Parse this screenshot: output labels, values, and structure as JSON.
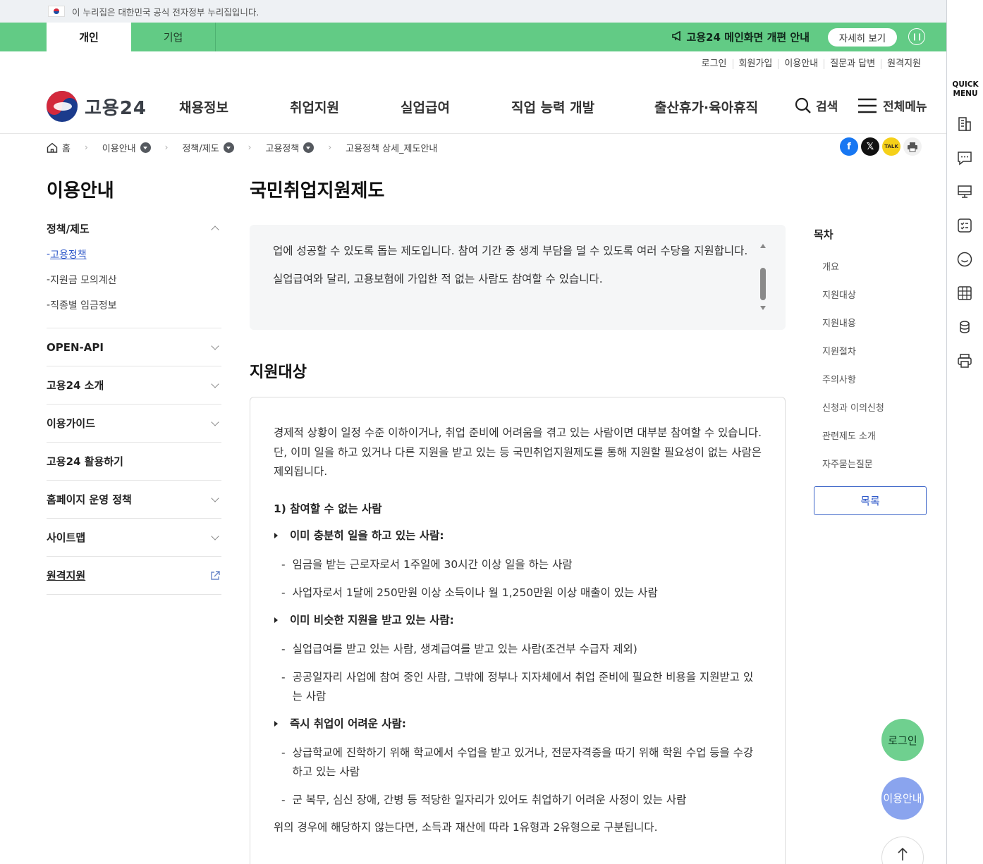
{
  "gov_banner": {
    "text": "이 누리집은 대한민국 공식 전자정부 누리집입니다."
  },
  "tabs": {
    "personal": "개인",
    "company": "기업"
  },
  "notice": {
    "text": "고용24 메인화면 개편 안내",
    "detail_button": "자세히 보기"
  },
  "util_links": [
    "로그인",
    "회원가입",
    "이용안내",
    "질문과 답변",
    "원격지원"
  ],
  "logo": {
    "text": "고용24"
  },
  "gnb": [
    "채용정보",
    "취업지원",
    "실업급여",
    "직업 능력 개발",
    "출산휴가·육아휴직"
  ],
  "header_actions": {
    "search": "검색",
    "menu": "전체메뉴"
  },
  "breadcrumb": {
    "home": "홈",
    "items": [
      "이용안내",
      "정책/제도",
      "고용정책"
    ],
    "current": "고용정책 상세_제도안내"
  },
  "lnb": {
    "title": "이용안내",
    "group1": {
      "title": "정책/제도",
      "items": [
        "고용정책",
        "지원금 모의계산",
        "직종별 임금정보"
      ]
    },
    "groups": [
      "OPEN-API",
      "고용24 소개",
      "이용가이드",
      "고용24 활용하기",
      "홈페이지 운영 정책",
      "사이트맵"
    ],
    "remote": "원격지원"
  },
  "page": {
    "title": "국민취업지원제도",
    "intro": [
      "업에 성공할 수 있도록 돕는 제도입니다. 참여 기간 중 생계 부담을 덜 수 있도록 여러 수당을 지원합니다.",
      "실업급여와 달리, 고용보험에 가입한 적 없는 사람도 참여할 수 있습니다."
    ],
    "section_title": "지원대상",
    "section_para": "경제적 상황이 일정 수준 이하이거나, 취업 준비에 어려움을 겪고 있는 사람이면 대부분 참여할 수 있습니다. 단, 이미 일을 하고 있거나 다른 지원을 받고 있는 등 국민취업지원제도를 통해 지원할 필요성이 없는 사람은 제외됩니다.",
    "sub_heading": "1) 참여할 수 없는 사람",
    "bullets": [
      {
        "title": "이미 충분히 일을 하고 있는 사람:",
        "items": [
          "임금을 받는 근로자로서 1주일에 30시간 이상 일을 하는 사람",
          "사업자로서 1달에 250만원 이상 소득이나 월 1,250만원 이상 매출이 있는 사람"
        ]
      },
      {
        "title": "이미 비슷한 지원을 받고 있는 사람:",
        "items": [
          "실업급여를 받고 있는 사람, 생계급여를 받고 있는 사람(조건부 수급자 제외)",
          "공공일자리 사업에 참여 중인 사람, 그밖에 정부나 지자체에서 취업 준비에 필요한 비용을 지원받고 있는 사람"
        ]
      },
      {
        "title": "즉시 취업이 어려운 사람:",
        "items": [
          "상급학교에 진학하기 위해 학교에서 수업을 받고 있거나, 전문자격증을 따기 위해 학원 수업 등을 수강하고 있는 사람",
          "군 복무, 심신 장애, 간병 등 적당한 일자리가 있어도 취업하기 어려운 사정이 있는 사람"
        ]
      }
    ],
    "closing": "위의 경우에 해당하지 않는다면, 소득과 재산에 따라 1유형과 2유형으로 구분됩니다."
  },
  "toc": {
    "title": "목차",
    "items": [
      "개요",
      "지원대상",
      "지원내용",
      "지원절차",
      "주의사항",
      "신청과 이의신청",
      "관련제도 소개",
      "자주묻는질문"
    ],
    "list_button": "목록"
  },
  "quick": {
    "title_line1": "QUICK",
    "title_line2": "MENU"
  },
  "floating": {
    "login": "로그인",
    "guide_line1": "이용",
    "guide_line2": "안내"
  }
}
